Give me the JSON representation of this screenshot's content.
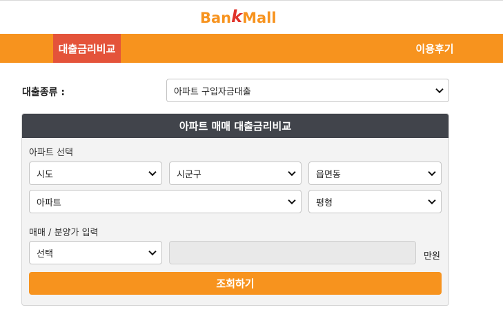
{
  "header": {
    "logo_prefix": "Ban",
    "logo_mark": "k",
    "logo_suffix": "Mall"
  },
  "nav": {
    "items": [
      {
        "label": "대출금리비교",
        "active": true
      },
      {
        "label": "이용후기",
        "active": false
      }
    ]
  },
  "loan_type": {
    "label": "대출종류 :",
    "selected": "아파트 구입자금대출"
  },
  "panel": {
    "title": "아파트 매매 대출금리비교",
    "apartment_section_label": "아파트 선택",
    "sido": {
      "selected": "시도"
    },
    "sigungu": {
      "selected": "시군구"
    },
    "eupmyeondong": {
      "selected": "읍면동"
    },
    "apartment": {
      "selected": "아파트"
    },
    "area": {
      "selected": "평형"
    },
    "price_section_label": "매매 / 분양가 입력",
    "price_type": {
      "selected": "선택"
    },
    "price_input": {
      "value": ""
    },
    "price_unit": "만원",
    "submit_label": "조회하기"
  },
  "colors": {
    "brand_orange": "#f7931e",
    "active_tab": "#e4533a",
    "panel_header": "#41444b"
  }
}
